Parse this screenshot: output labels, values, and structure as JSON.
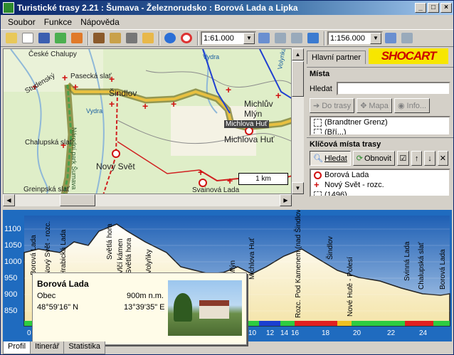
{
  "window": {
    "title": "Turistické trasy 2.21 : Šumava - Železnorudsko : Borová Lada a Lipka"
  },
  "menu": [
    "Soubor",
    "Funkce",
    "Nápověda"
  ],
  "toolbar": {
    "scale1": "1:61.000",
    "scale2": "1:156.000"
  },
  "map": {
    "labels": [
      "České Chalupy",
      "Pasecká slať",
      "Studenský",
      "Šindlov",
      "Národní park Šumava",
      "Vydra",
      "Michlův Mlýn",
      "Michlova Huť",
      "Michlova Huť",
      "Chalupská slať",
      "Nový Svět",
      "Greinpská slať",
      "Svainová Lada",
      "Vydra",
      "Volynka"
    ],
    "scale_label": "1 km"
  },
  "right_panel": {
    "tab_partner": "Hlavní partner",
    "logo_text": "SHOCART",
    "places_title": "Místa",
    "search_label": "Hledat",
    "btn_to_route": "Do trasy",
    "btn_map": "Mapa",
    "btn_info": "Info...",
    "places_list": [
      "(Brandtner Grenz)",
      "(Bří...)"
    ],
    "key_title": "Klíčová místa trasy",
    "btn_search": "Hledat",
    "btn_refresh": "Obnovit",
    "key_list": [
      "Borová Lada",
      "Nový Svět - rozc.",
      "(1496)"
    ]
  },
  "profile": {
    "y_ticks": [
      "1100",
      "1050",
      "1000",
      "950",
      "900",
      "850"
    ],
    "x_ticks": [
      "0",
      "10",
      "12",
      "14",
      "16",
      "18",
      "20",
      "22",
      "24"
    ],
    "place_labels": [
      "Borová Lada",
      "Nový Svět - rozc.",
      "Hrabická Lada",
      "Světlá hora",
      "Vlčí kámen",
      "Světlá hora",
      "Volyňky",
      "Mlýn",
      "Michlova Huť",
      "Rozc. Pod Kamenem (nad Šindlovem)",
      "Šindlov",
      "Nové Hutě - Polesí",
      "Svinná Lada",
      "Chalupská slať",
      "Borová Lada"
    ],
    "popup": {
      "name": "Borová Lada",
      "type": "Obec",
      "elevation": "900m n.m.",
      "lat": "48°59'16\" N",
      "lon": "13°39'35\" E"
    },
    "tabs": [
      "Profil",
      "Itinerář",
      "Statistika"
    ]
  }
}
